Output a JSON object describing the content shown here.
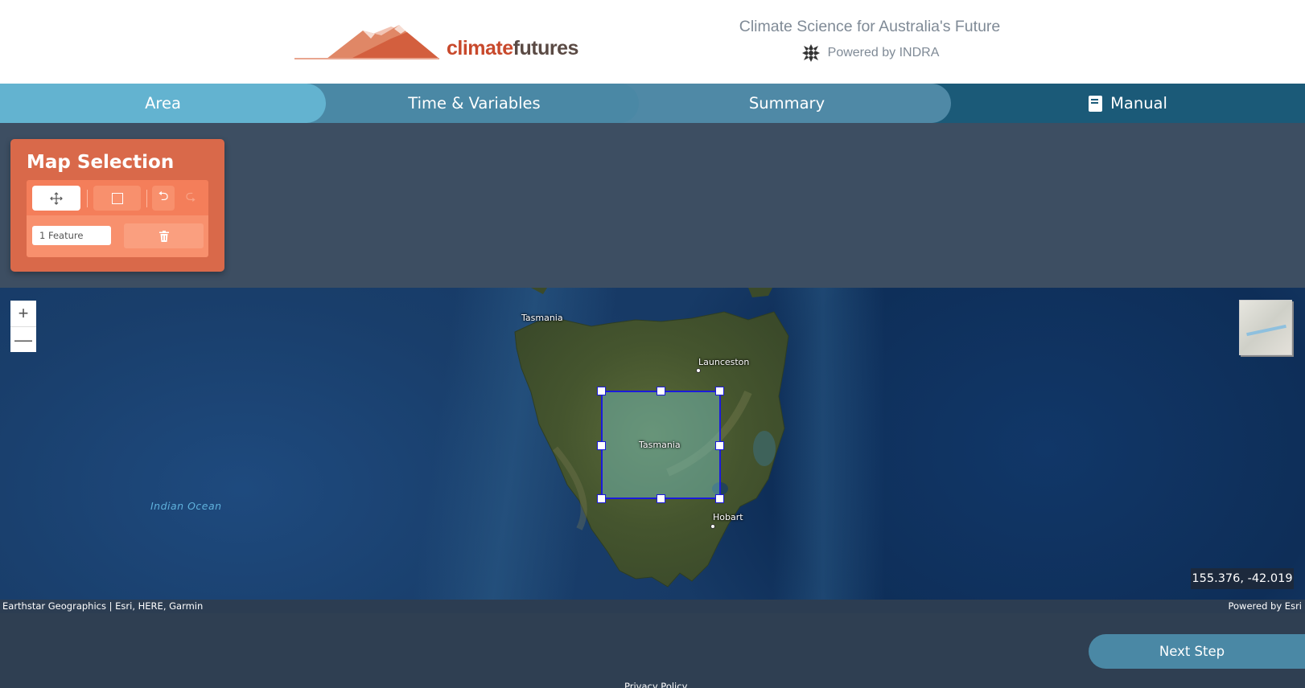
{
  "header": {
    "logo": {
      "part1": "climate",
      "part2": "futures"
    },
    "tagline": "Climate Science for Australia's Future",
    "powered_by": "Powered by INDRA"
  },
  "nav": {
    "tabs": [
      {
        "label": "Area",
        "active": true
      },
      {
        "label": "Time & Variables"
      },
      {
        "label": "Summary"
      },
      {
        "label": "Manual",
        "icon": "book-icon"
      }
    ]
  },
  "map_selection": {
    "title": "Map Selection",
    "tools": [
      {
        "name": "move",
        "icon": "move-icon",
        "active": true
      },
      {
        "name": "rectangle",
        "icon": "rectangle-icon"
      },
      {
        "name": "undo",
        "icon": "undo-icon"
      },
      {
        "name": "redo",
        "icon": "redo-icon",
        "disabled": true
      }
    ],
    "feature_count": "1 Feature",
    "delete_icon": "trash-icon"
  },
  "map": {
    "labels": {
      "tasmania_north": "Tasmania",
      "launceston": "Launceston",
      "tasmania_center": "Tasmania",
      "hobart": "Hobart",
      "indian_ocean": "Indian Ocean"
    },
    "zoom_in": "+",
    "zoom_out": "—",
    "coordinates": "155.376, -42.019",
    "attribution_left": "Earthstar Geographics | Esri, HERE, Garmin",
    "attribution_right": "Powered by Esri"
  },
  "footer": {
    "next_button": "Next Step",
    "privacy": "Privacy Policy"
  },
  "colors": {
    "accent": "#d9694a",
    "nav_dark": "#1b5a78",
    "nav_active": "#63b3d0",
    "page_bg": "#3d4e62"
  }
}
